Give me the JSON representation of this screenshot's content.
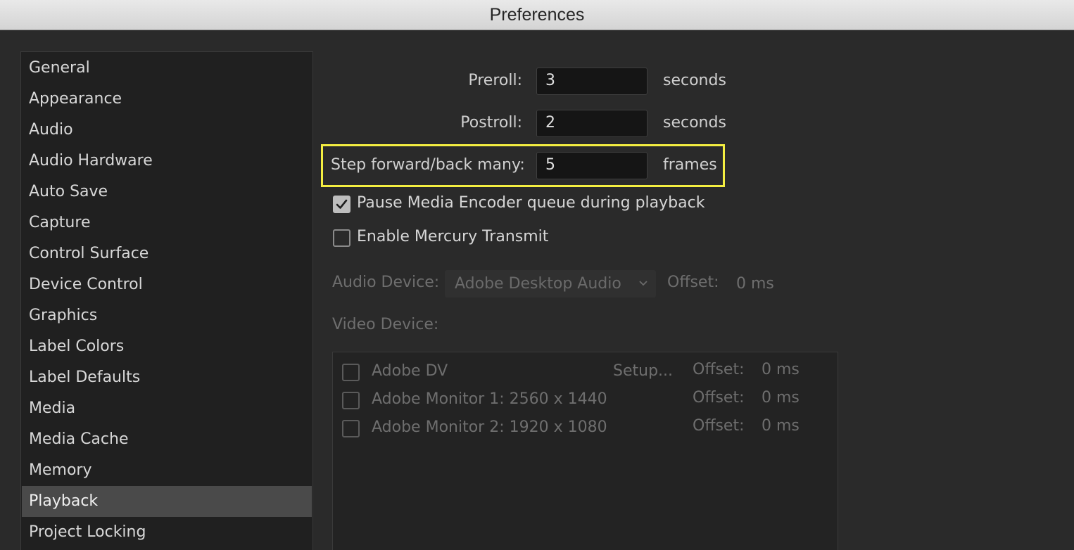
{
  "window": {
    "title": "Preferences"
  },
  "sidebar": {
    "items": [
      {
        "label": "General"
      },
      {
        "label": "Appearance"
      },
      {
        "label": "Audio"
      },
      {
        "label": "Audio Hardware"
      },
      {
        "label": "Auto Save"
      },
      {
        "label": "Capture"
      },
      {
        "label": "Control Surface"
      },
      {
        "label": "Device Control"
      },
      {
        "label": "Graphics"
      },
      {
        "label": "Label Colors"
      },
      {
        "label": "Label Defaults"
      },
      {
        "label": "Media"
      },
      {
        "label": "Media Cache"
      },
      {
        "label": "Memory"
      },
      {
        "label": "Playback",
        "selected": true
      },
      {
        "label": "Project Locking"
      }
    ]
  },
  "playback": {
    "preroll": {
      "label": "Preroll:",
      "value": "3",
      "unit": "seconds"
    },
    "postroll": {
      "label": "Postroll:",
      "value": "2",
      "unit": "seconds"
    },
    "step": {
      "label": "Step forward/back many:",
      "value": "5",
      "unit": "frames"
    },
    "pause_encoder": {
      "label": "Pause Media Encoder queue during playback",
      "checked": true
    },
    "mercury": {
      "label": "Enable Mercury Transmit",
      "checked": false
    },
    "audio_device": {
      "label": "Audio Device:",
      "selected": "Adobe Desktop Audio",
      "offset_label": "Offset:",
      "offset_value": "0 ms"
    },
    "video_device": {
      "label": "Video Device:",
      "devices": [
        {
          "name": "Adobe DV",
          "setup": "Setup...",
          "offset_label": "Offset:",
          "offset_value": "0 ms",
          "checked": false
        },
        {
          "name": "Adobe Monitor 1: 2560 x 1440",
          "setup": "",
          "offset_label": "Offset:",
          "offset_value": "0 ms",
          "checked": false
        },
        {
          "name": "Adobe Monitor 2: 1920 x 1080",
          "setup": "",
          "offset_label": "Offset:",
          "offset_value": "0 ms",
          "checked": false
        }
      ]
    }
  },
  "colors": {
    "highlight": "#f4ee41",
    "selected_nav": "#4a4a4a",
    "background": "#2a2a2a"
  }
}
